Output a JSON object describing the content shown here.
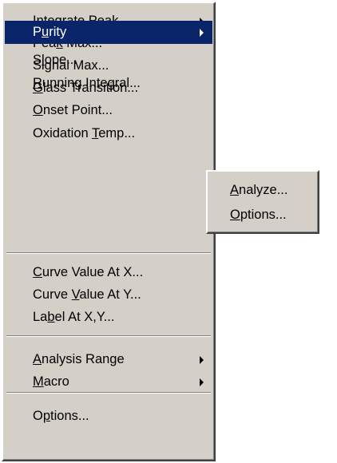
{
  "main_menu": {
    "items": [
      {
        "pre": "",
        "acc": "I",
        "post": "ntegrate Peak",
        "submenu": true
      },
      {
        "pre": "Pea",
        "acc": "k",
        "post": " Max...",
        "submenu": false
      },
      {
        "pre": "Si",
        "acc": "g",
        "post": "nal Max...",
        "submenu": false
      },
      {
        "pre": "",
        "acc": "G",
        "post": "lass Transition...",
        "submenu": false
      },
      {
        "pre": "",
        "acc": "O",
        "post": "nset Point...",
        "submenu": false
      },
      {
        "pre": "Oxidation ",
        "acc": "T",
        "post": "emp...",
        "submenu": false
      },
      {
        "pre": "P",
        "acc": "u",
        "post": "rity",
        "submenu": true,
        "highlighted": true
      },
      {
        "pre": "S",
        "acc": "l",
        "post": "ope...",
        "submenu": false
      },
      {
        "pre": "",
        "acc": "R",
        "post": "unning Integral...",
        "submenu": false
      },
      {
        "pre": "",
        "acc": "C",
        "post": "urve Value At X...",
        "submenu": false
      },
      {
        "pre": "Curve ",
        "acc": "V",
        "post": "alue At Y...",
        "submenu": false
      },
      {
        "pre": "La",
        "acc": "b",
        "post": "el At X,Y...",
        "submenu": false
      },
      {
        "pre": "",
        "acc": "A",
        "post": "nalysis Range",
        "submenu": true
      },
      {
        "pre": "",
        "acc": "M",
        "post": "acro",
        "submenu": true
      },
      {
        "pre": "O",
        "acc": "p",
        "post": "tions...",
        "submenu": false
      }
    ]
  },
  "sub_menu": {
    "items": [
      {
        "pre": "",
        "acc": "A",
        "post": "nalyze..."
      },
      {
        "pre": "",
        "acc": "O",
        "post": "ptions..."
      }
    ]
  },
  "colors": {
    "menu_face": "#d4d0c8",
    "highlight": "#0a246a",
    "highlight_text": "#ffffff"
  }
}
